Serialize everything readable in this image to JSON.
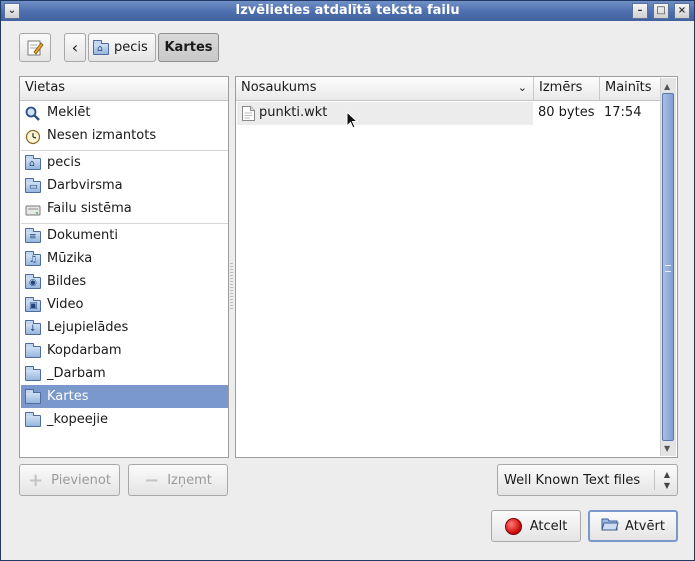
{
  "window": {
    "title": "Izvēlieties atdalītā teksta failu"
  },
  "titlebar_buttons": {
    "menu": "⌄",
    "minimize": "–",
    "maximize": "□",
    "close": "×"
  },
  "pathbar": {
    "back_glyph": "‹",
    "home_label": "pecis",
    "current_label": "Kartes"
  },
  "places": {
    "header": "Vietas",
    "items": [
      {
        "label": "Meklēt",
        "icon": "search-icon"
      },
      {
        "label": "Nesen izmantots",
        "icon": "clock-icon"
      },
      {
        "label": "pecis",
        "icon": "home-folder-icon"
      },
      {
        "label": "Darbvirsma",
        "icon": "desktop-folder-icon"
      },
      {
        "label": "Failu sistēma",
        "icon": "drive-icon"
      },
      {
        "label": "Dokumenti",
        "icon": "documents-folder-icon"
      },
      {
        "label": "Mūzika",
        "icon": "music-folder-icon"
      },
      {
        "label": "Bildes",
        "icon": "pictures-folder-icon"
      },
      {
        "label": "Video",
        "icon": "video-folder-icon"
      },
      {
        "label": "Lejupielādes",
        "icon": "downloads-folder-icon"
      },
      {
        "label": "Kopdarbam",
        "icon": "folder-icon"
      },
      {
        "label": "_Darbam",
        "icon": "folder-icon"
      },
      {
        "label": "Kartes",
        "icon": "folder-icon",
        "selected": true
      },
      {
        "label": "_kopeejie",
        "icon": "folder-icon"
      }
    ],
    "add_label": "Pievienot",
    "remove_label": "Izņemt"
  },
  "files": {
    "columns": {
      "name": "Nosaukums",
      "size": "Izmērs",
      "modified": "Mainīts"
    },
    "rows": [
      {
        "name": "punkti.wkt",
        "size": "80 bytes",
        "modified": "17:54",
        "icon": "text-file-icon"
      }
    ]
  },
  "filter": {
    "selected": "Well Known Text files"
  },
  "actions": {
    "cancel_label": "Atcelt",
    "open_label": "Atvērt"
  },
  "colors": {
    "selection": "#7a98cc",
    "titlebar": "#4d6fae"
  }
}
